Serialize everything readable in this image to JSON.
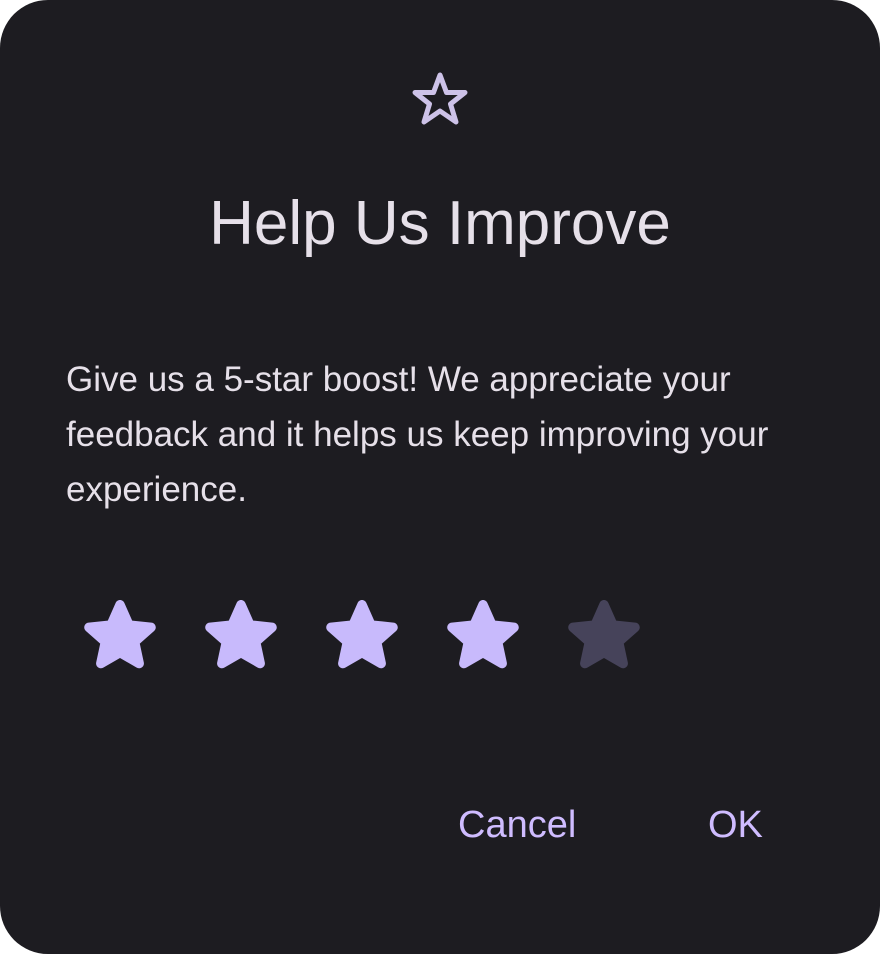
{
  "dialog": {
    "icon": "star-outline-icon",
    "title": "Help Us Improve",
    "message": "Give us a 5-star boost! We appreciate your feedback and it helps us keep improving your experience.",
    "rating": {
      "value": 4,
      "max": 5,
      "star_icon": "star-icon"
    },
    "actions": {
      "cancel_label": "Cancel",
      "ok_label": "OK"
    }
  },
  "colors": {
    "surface": "#1d1c21",
    "on_surface": "#e6e0e9",
    "accent": "#cfbcff",
    "star_filled": "#c8bafc",
    "star_empty": "#46435a",
    "header_icon": "#cdc2e8"
  }
}
